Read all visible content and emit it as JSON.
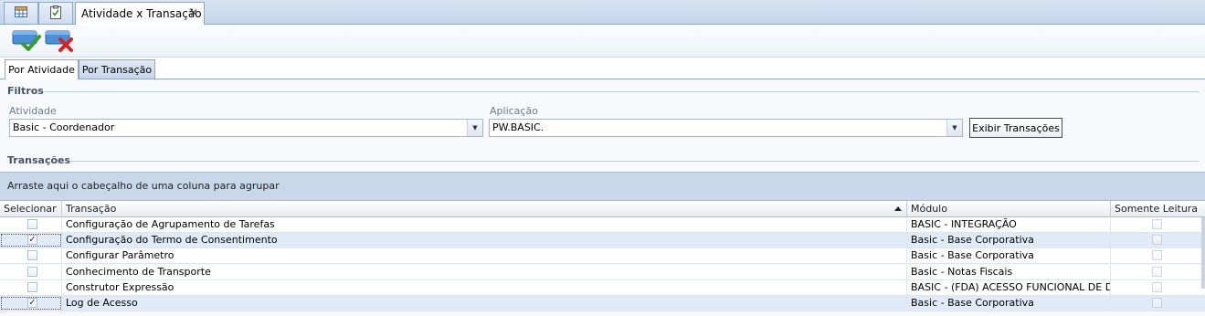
{
  "tabs": {
    "icon_tab_1": "grid-icon",
    "icon_tab_2": "clipboard-check-icon",
    "document_tab_label": "Atividade x Transação",
    "close_glyph": "✕"
  },
  "toolbar": {
    "confirm_icon": "confirm-check-icon",
    "cancel_icon": "cancel-x-icon"
  },
  "subtabs": {
    "por_atividade": "Por Atividade",
    "por_transacao": "Por Transação"
  },
  "filters": {
    "title": "Filtros",
    "atividade_label": "Atividade",
    "atividade_value": "Basic - Coordenador",
    "aplicacao_label": "Aplicação",
    "aplicacao_value": "PW.BASIC.",
    "exibir_button": "Exibir Transações"
  },
  "transacoes": {
    "title": "Transações",
    "group_hint": "Arraste aqui o cabeçalho de uma coluna para agrupar",
    "columns": [
      "Selecionar",
      "Transação",
      "Módulo",
      "Somente Leitura"
    ],
    "rows": [
      {
        "selected": false,
        "transacao": "Configuração de Agrupamento de Tarefas",
        "modulo": "BASIC - INTEGRAÇÃO",
        "somente_leitura": false
      },
      {
        "selected": true,
        "transacao": "Configuração do Termo de Consentimento",
        "modulo": "Basic - Base Corporativa",
        "somente_leitura": false
      },
      {
        "selected": false,
        "transacao": "Configurar Parâmetro",
        "modulo": "Basic - Base Corporativa",
        "somente_leitura": false
      },
      {
        "selected": false,
        "transacao": "Conhecimento de Transporte",
        "modulo": "Basic - Notas Fiscais",
        "somente_leitura": false
      },
      {
        "selected": false,
        "transacao": "Construtor Expressão",
        "modulo": "BASIC - (FDA) ACESSO FUNCIONAL DE DA...",
        "somente_leitura": false
      },
      {
        "selected": true,
        "transacao": "Log de Acesso",
        "modulo": "Basic - Base Corporativa",
        "somente_leitura": false
      }
    ]
  },
  "colors": {
    "accent": "#c9d7ea",
    "selected_row": "#e1ebf8",
    "confirm_green": "#3c9a2c",
    "cancel_red": "#d42121"
  }
}
